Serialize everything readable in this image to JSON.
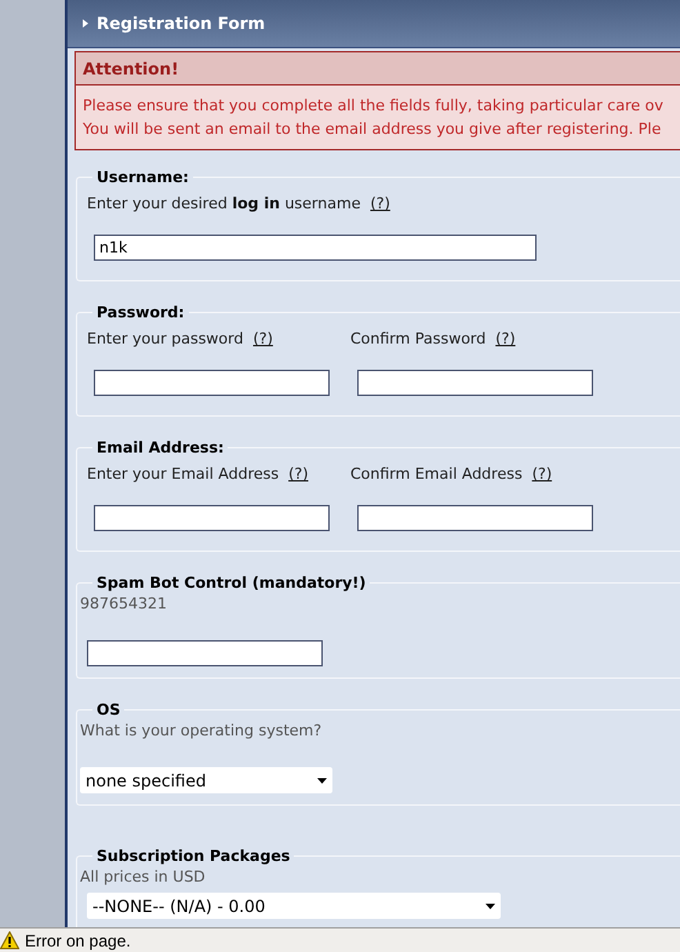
{
  "panel": {
    "title": "Registration Form"
  },
  "attention": {
    "title": "Attention!",
    "lines": [
      "Please ensure that you complete all the fields fully, taking particular care ov",
      "You will be sent an email to the email address you give after registering. Ple"
    ]
  },
  "sections": [
    {
      "legend": "Username:",
      "kind": "labelled",
      "fields": [
        {
          "kind": "longtext",
          "label": "Enter your desired **log in** username",
          "help": "(?)",
          "value": "n1k"
        }
      ]
    },
    {
      "legend": "Password:",
      "kind": "labelled",
      "fields": [
        {
          "kind": "text",
          "label": "Enter your password",
          "help": "(?)"
        },
        {
          "kind": "text",
          "label": "Confirm Password",
          "help": "(?)"
        }
      ]
    },
    {
      "legend": "Email Address:",
      "kind": "labelled",
      "fields": [
        {
          "kind": "text",
          "label": "Enter your Email Address",
          "help": "(?)"
        },
        {
          "kind": "text",
          "label": "Confirm Email Address",
          "help": "(?)"
        }
      ]
    },
    {
      "legend": "Spam Bot Control (mandatory!)",
      "kind": "noted",
      "note": "987654321",
      "fields": [
        {
          "kind": "text"
        }
      ]
    },
    {
      "legend": "OS",
      "kind": "noted",
      "note": "What is your operating system?",
      "fields": [
        {
          "kind": "select",
          "value": "none specified"
        }
      ]
    },
    {
      "legend": "Subscription Packages",
      "kind": "noted",
      "note": "All prices in USD",
      "fields": [
        {
          "kind": "longselect",
          "value": "--NONE-- (N/A) - 0.00"
        }
      ]
    }
  ],
  "status_bar": {
    "text": "Error on page."
  }
}
